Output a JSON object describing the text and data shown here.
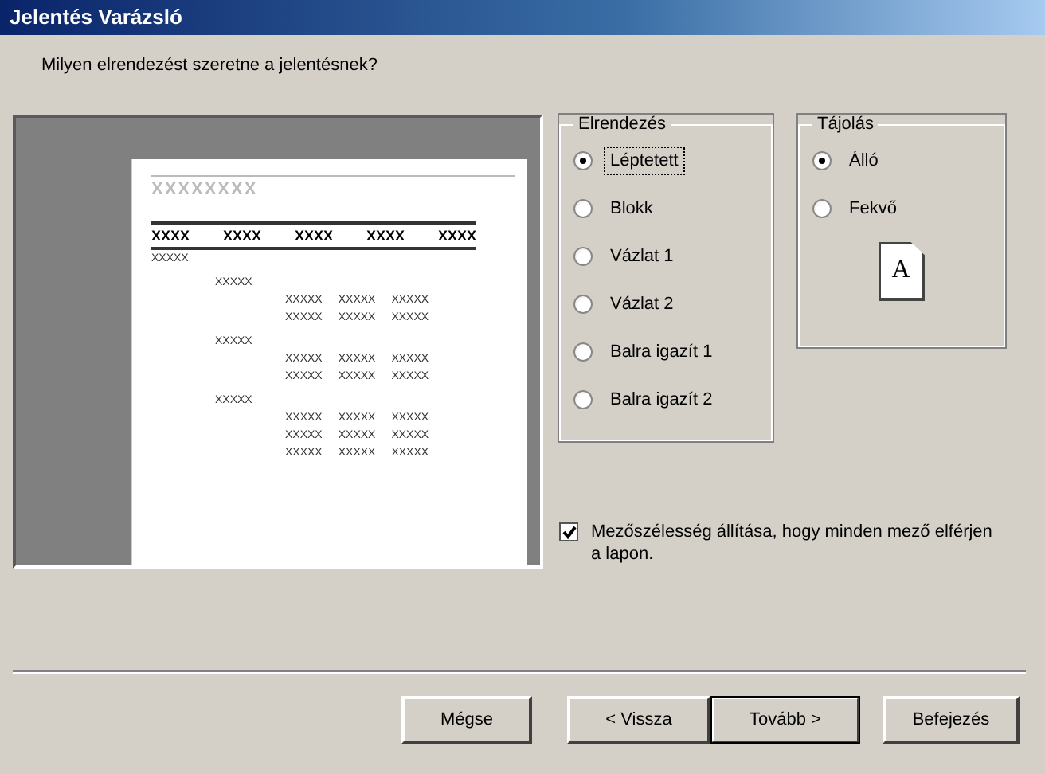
{
  "window": {
    "title": "Jelentés Varázsló"
  },
  "question": "Milyen elrendezést szeretne a jelentésnek?",
  "preview": {
    "title": "XXXXXXXX",
    "headers": [
      "XXXX",
      "XXXX",
      "XXXX",
      "XXXX",
      "XXXX"
    ],
    "rows": [
      {
        "kind": "group1",
        "cells": [
          "XXXXX"
        ]
      },
      {
        "kind": "group2",
        "cells": [
          "XXXXX"
        ]
      },
      {
        "kind": "detail",
        "cells": [
          "XXXXX",
          "XXXXX",
          "XXXXX"
        ]
      },
      {
        "kind": "detail",
        "cells": [
          "XXXXX",
          "XXXXX",
          "XXXXX"
        ]
      },
      {
        "kind": "group2",
        "cells": [
          "XXXXX"
        ]
      },
      {
        "kind": "detail",
        "cells": [
          "XXXXX",
          "XXXXX",
          "XXXXX"
        ]
      },
      {
        "kind": "detail",
        "cells": [
          "XXXXX",
          "XXXXX",
          "XXXXX"
        ]
      },
      {
        "kind": "group2",
        "cells": [
          "XXXXX"
        ]
      },
      {
        "kind": "detail",
        "cells": [
          "XXXXX",
          "XXXXX",
          "XXXXX"
        ]
      },
      {
        "kind": "detail",
        "cells": [
          "XXXXX",
          "XXXXX",
          "XXXXX"
        ]
      },
      {
        "kind": "detail",
        "cells": [
          "XXXXX",
          "XXXXX",
          "XXXXX"
        ]
      }
    ]
  },
  "layout_group": {
    "title": "Elrendezés",
    "options": [
      {
        "label": "Léptetett",
        "selected": true
      },
      {
        "label": "Blokk",
        "selected": false
      },
      {
        "label": "Vázlat 1",
        "selected": false
      },
      {
        "label": "Vázlat 2",
        "selected": false
      },
      {
        "label": "Balra igazít 1",
        "selected": false
      },
      {
        "label": "Balra igazít 2",
        "selected": false
      }
    ]
  },
  "orientation_group": {
    "title": "Tájolás",
    "options": [
      {
        "label": "Álló",
        "selected": true
      },
      {
        "label": "Fekvő",
        "selected": false
      }
    ],
    "page_letter": "A"
  },
  "fit_checkbox": {
    "label": "Mezőszélesség állítása, hogy minden mező elférjen a lapon.",
    "checked": true
  },
  "buttons": [
    {
      "label": "Mégse",
      "default": false
    },
    {
      "label": "< Vissza",
      "default": false
    },
    {
      "label": "Tovább >",
      "default": true
    },
    {
      "label": "Befejezés",
      "default": false
    }
  ]
}
